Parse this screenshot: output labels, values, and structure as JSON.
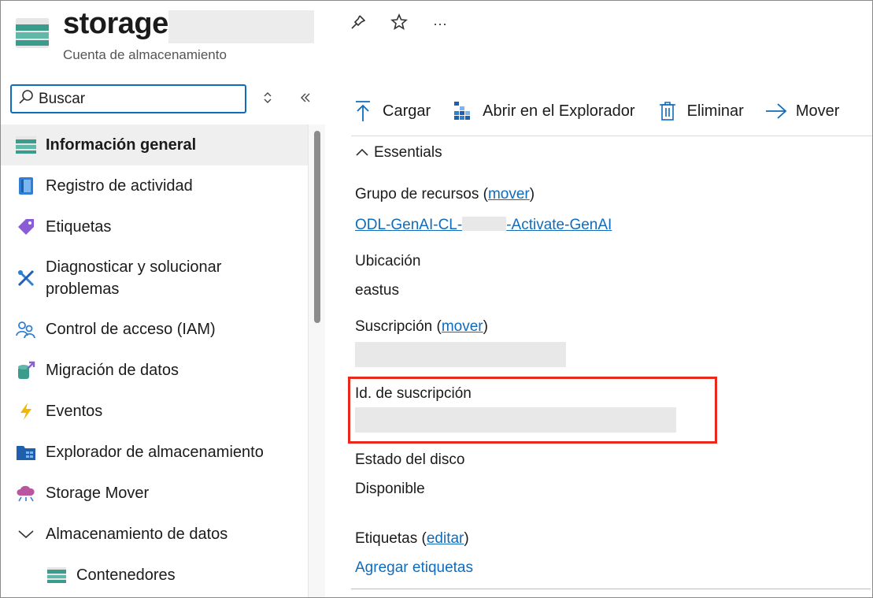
{
  "header": {
    "title": "storage",
    "subtitle": "Cuenta de almacenamiento",
    "actions": {
      "pin_icon": "pin-icon",
      "favorite_icon": "star-icon",
      "more_label": "···"
    }
  },
  "search": {
    "placeholder": "Buscar"
  },
  "sidebar": {
    "items": [
      {
        "label": "Información general",
        "icon": "overview-icon",
        "active": true
      },
      {
        "label": "Registro de actividad",
        "icon": "activity-log-icon"
      },
      {
        "label": "Etiquetas",
        "icon": "tag-icon"
      },
      {
        "label": "Diagnosticar y solucionar problemas",
        "icon": "wrench-icon"
      },
      {
        "label": "Control de acceso (IAM)",
        "icon": "people-icon"
      },
      {
        "label": "Migración de datos",
        "icon": "migration-icon"
      },
      {
        "label": "Eventos",
        "icon": "lightning-icon"
      },
      {
        "label": "Explorador de almacenamiento",
        "icon": "storage-explorer-icon"
      },
      {
        "label": "Storage Mover",
        "icon": "cloud-icon"
      },
      {
        "label": "Almacenamiento de datos",
        "icon": "chevron-down-icon",
        "expanded": true
      },
      {
        "label": "Contenedores",
        "icon": "container-icon",
        "child": true
      }
    ]
  },
  "toolbar": {
    "upload": "Cargar",
    "open_explorer": "Abrir en el Explorador",
    "delete": "Eliminar",
    "move": "Mover"
  },
  "essentials": {
    "toggle_label": "Essentials",
    "resource_group_label": "Grupo de recursos",
    "move_link": "mover",
    "resource_group_value_prefix": "ODL-GenAI-CL-",
    "resource_group_value_suffix": "-Activate-GenAI",
    "location_label": "Ubicación",
    "location_value": "eastus",
    "subscription_label": "Suscripción",
    "subscription_id_label": "Id. de suscripción",
    "disk_state_label": "Estado del disco",
    "disk_state_value": "Disponible",
    "tags_label": "Etiquetas",
    "edit_link": "editar",
    "add_tags_link": "Agregar etiquetas"
  },
  "colors": {
    "accent": "#0f6cbd",
    "highlight_border": "#e8291c",
    "active_item_bg": "#efefef"
  }
}
